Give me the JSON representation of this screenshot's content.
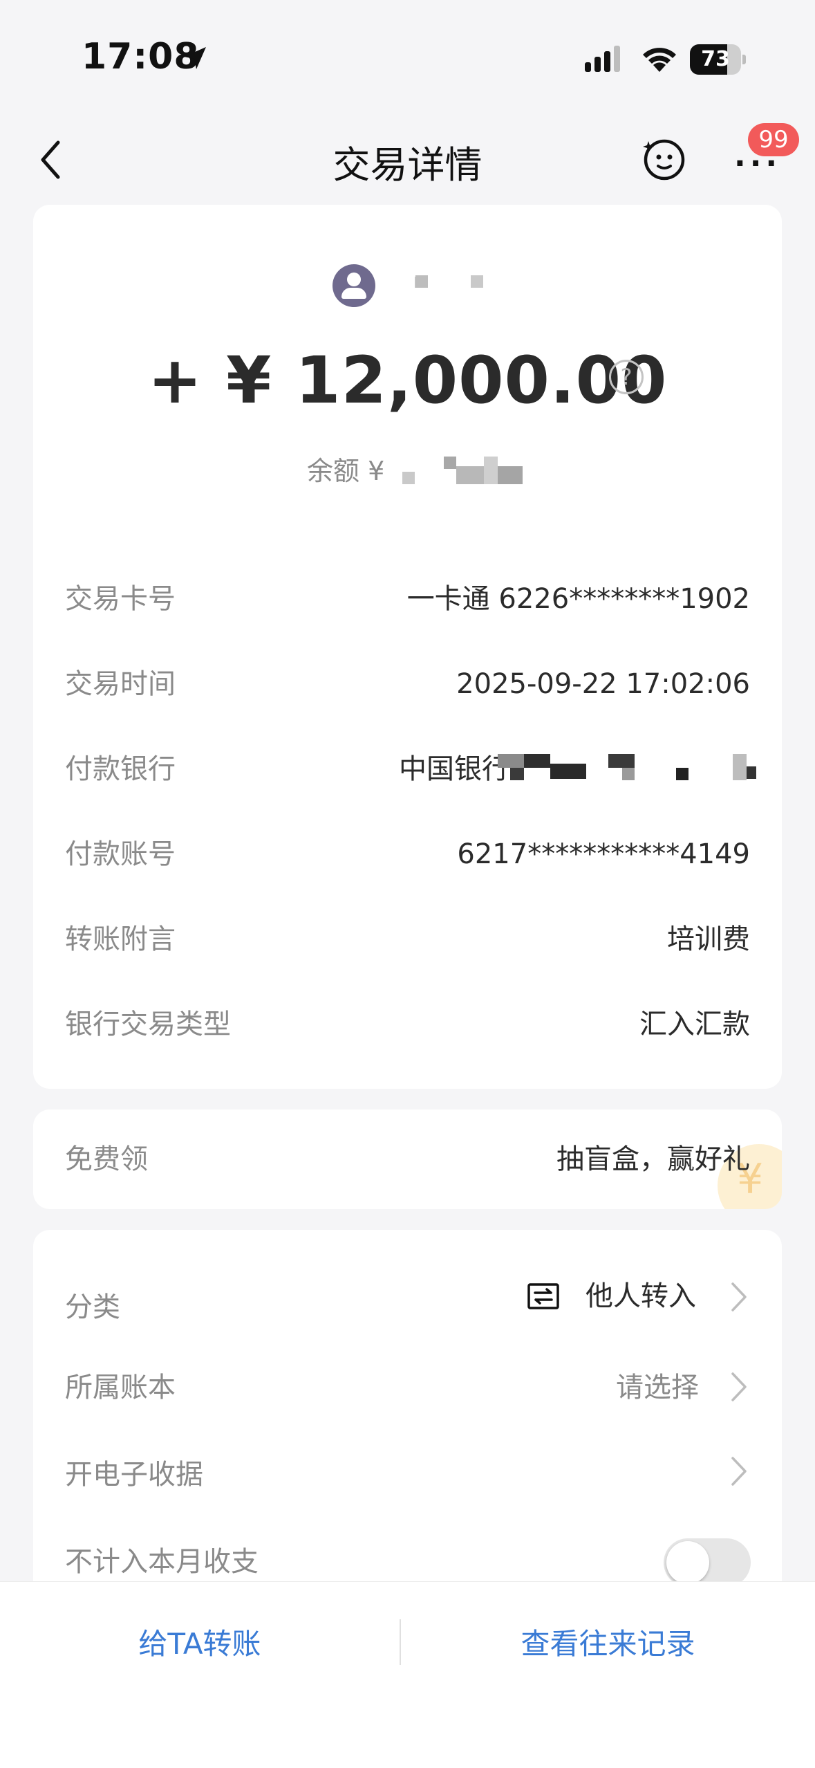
{
  "status_bar": {
    "time": "17:08",
    "battery": "73",
    "battery_level": 0.73
  },
  "nav": {
    "title": "交易详情",
    "badge": "99"
  },
  "summary": {
    "amount": "+ ¥ 12,000.00",
    "help": "?",
    "balance_label": "余额 ¥"
  },
  "details": [
    {
      "label": "交易卡号",
      "value": "一卡通 6226********1902"
    },
    {
      "label": "交易时间",
      "value": "2025-09-22 17:02:06"
    },
    {
      "label": "付款银行",
      "value": "中国银行"
    },
    {
      "label": "付款账号",
      "value": "6217***********4149"
    },
    {
      "label": "转账附言",
      "value": "培训费"
    },
    {
      "label": "银行交易类型",
      "value": "汇入汇款"
    }
  ],
  "promo": {
    "label": "免费领",
    "value": "抽盲盒，赢好礼"
  },
  "settings": {
    "category": {
      "label": "分类",
      "value": "他人转入"
    },
    "ledger": {
      "label": "所属账本",
      "value": "请选择"
    },
    "receipt": {
      "label": "开电子收据"
    },
    "exclude": {
      "label": "不计入本月收支",
      "enabled": false
    }
  },
  "actions": {
    "transfer": "给TA转账",
    "history": "查看往来记录"
  },
  "colors": {
    "accent": "#3a7bd5",
    "badge": "#f25a5a",
    "avatar": "#6f6a8e"
  }
}
